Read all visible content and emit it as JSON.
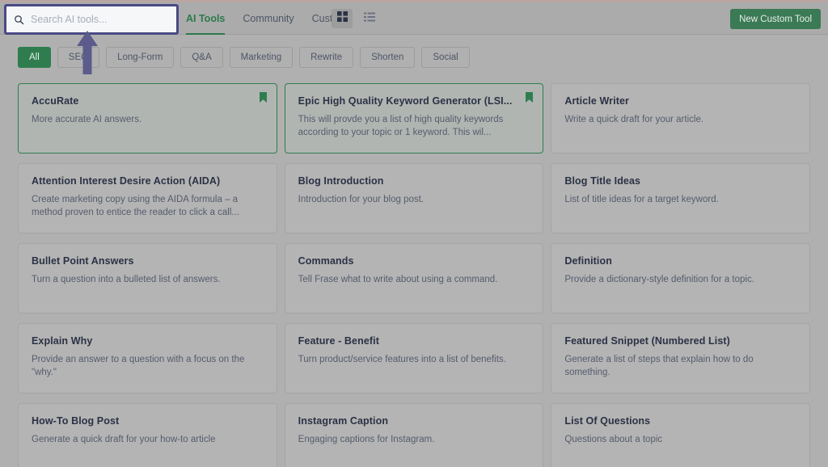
{
  "header": {
    "search": {
      "placeholder": "Search AI tools...",
      "value": "",
      "icon": "search-icon"
    },
    "nav": [
      {
        "label": "AI Tools",
        "active": true
      },
      {
        "label": "Community",
        "active": false
      },
      {
        "label": "Custom",
        "active": false
      }
    ],
    "view_toggles": [
      {
        "icon": "grid-view-icon",
        "active": true
      },
      {
        "icon": "list-view-icon",
        "active": false
      }
    ],
    "new_tool_button": "New Custom Tool"
  },
  "filters": [
    {
      "label": "All",
      "active": true
    },
    {
      "label": "SEO",
      "active": false
    },
    {
      "label": "Long-Form",
      "active": false
    },
    {
      "label": "Q&A",
      "active": false
    },
    {
      "label": "Marketing",
      "active": false
    },
    {
      "label": "Rewrite",
      "active": false
    },
    {
      "label": "Shorten",
      "active": false
    },
    {
      "label": "Social",
      "active": false
    }
  ],
  "cards": [
    {
      "title": "AccuRate",
      "desc": "More accurate AI answers.",
      "selected": true,
      "bookmarked": true
    },
    {
      "title": "Epic High Quality Keyword Generator (LSI...",
      "desc": "This will provde you a list of high quality keywords according to your topic or 1 keyword. This wil...",
      "selected": true,
      "bookmarked": true
    },
    {
      "title": "Article Writer",
      "desc": "Write a quick draft for your article.",
      "selected": false,
      "bookmarked": false
    },
    {
      "title": "Attention Interest Desire Action (AIDA)",
      "desc": "Create marketing copy using the AIDA formula – a method proven to entice the reader to click a call...",
      "selected": false,
      "bookmarked": false
    },
    {
      "title": "Blog Introduction",
      "desc": "Introduction for your blog post.",
      "selected": false,
      "bookmarked": false
    },
    {
      "title": "Blog Title Ideas",
      "desc": "List of title ideas for a target keyword.",
      "selected": false,
      "bookmarked": false
    },
    {
      "title": "Bullet Point Answers",
      "desc": "Turn a question into a bulleted list of answers.",
      "selected": false,
      "bookmarked": false
    },
    {
      "title": "Commands",
      "desc": "Tell Frase what to write about using a command.",
      "selected": false,
      "bookmarked": false
    },
    {
      "title": "Definition",
      "desc": "Provide a dictionary-style definition for a topic.",
      "selected": false,
      "bookmarked": false
    },
    {
      "title": "Explain Why",
      "desc": "Provide an answer to a question with a focus on the \"why.\"",
      "selected": false,
      "bookmarked": false
    },
    {
      "title": "Feature - Benefit",
      "desc": "Turn product/service features into a list of benefits.",
      "selected": false,
      "bookmarked": false
    },
    {
      "title": "Featured Snippet (Numbered List)",
      "desc": "Generate a list of steps that explain how to do something.",
      "selected": false,
      "bookmarked": false
    },
    {
      "title": "How-To Blog Post",
      "desc": "Generate a quick draft for your how-to article",
      "selected": false,
      "bookmarked": false
    },
    {
      "title": "Instagram Caption",
      "desc": "Engaging captions for Instagram.",
      "selected": false,
      "bookmarked": false
    },
    {
      "title": "List Of Questions",
      "desc": "Questions about a topic",
      "selected": false,
      "bookmarked": false
    }
  ],
  "annotation": {
    "arrow": "up-arrow-annotation",
    "highlight_target": "search-input"
  },
  "colors": {
    "accent_green": "#2f7d4f",
    "annotation_purple": "#4a4a85",
    "overlay_grey": "#b0b0b0"
  }
}
